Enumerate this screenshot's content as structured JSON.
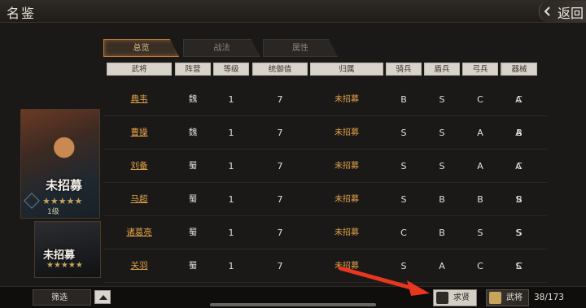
{
  "header": {
    "title": "名鉴",
    "back_label": "返回"
  },
  "tabs": [
    {
      "label": "总览",
      "active": true
    },
    {
      "label": "战法",
      "active": false
    },
    {
      "label": "属性",
      "active": false
    }
  ],
  "columns": [
    "武将",
    "阵营",
    "等级",
    "统御值",
    "归属",
    "骑兵",
    "盾兵",
    "弓兵",
    "枪兵",
    "器械"
  ],
  "rows": [
    {
      "name": "典韦",
      "faction": "魏",
      "level": "1",
      "command": "7",
      "status": "未招募",
      "cavalry": "B",
      "shield": "S",
      "archer": "C",
      "spear": "A",
      "siege": "C"
    },
    {
      "name": "曹操",
      "faction": "魏",
      "level": "1",
      "command": "7",
      "status": "未招募",
      "cavalry": "S",
      "shield": "S",
      "archer": "A",
      "spear": "A",
      "siege": "B"
    },
    {
      "name": "刘备",
      "faction": "蜀",
      "level": "1",
      "command": "7",
      "status": "未招募",
      "cavalry": "S",
      "shield": "S",
      "archer": "A",
      "spear": "A",
      "siege": "C"
    },
    {
      "name": "马超",
      "faction": "蜀",
      "level": "1",
      "command": "7",
      "status": "未招募",
      "cavalry": "S",
      "shield": "B",
      "archer": "B",
      "spear": "S",
      "siege": "B"
    },
    {
      "name": "诸葛亮",
      "faction": "蜀",
      "level": "1",
      "command": "7",
      "status": "未招募",
      "cavalry": "C",
      "shield": "B",
      "archer": "S",
      "spear": "S",
      "siege": "S"
    },
    {
      "name": "关羽",
      "faction": "蜀",
      "level": "1",
      "command": "7",
      "status": "未招募",
      "cavalry": "S",
      "shield": "A",
      "archer": "C",
      "spear": "S",
      "siege": "C"
    }
  ],
  "portraits": [
    {
      "status": "未招募",
      "stars": "★★★★★",
      "level": "1级"
    },
    {
      "status": "未招募",
      "stars": "★★★★★"
    }
  ],
  "footer": {
    "filter_label": "筛选",
    "seek_label": "求贤",
    "general_label": "武将",
    "count": "38/173"
  },
  "colors": {
    "accent": "#e0a24a",
    "arrow": "#e8361f"
  }
}
